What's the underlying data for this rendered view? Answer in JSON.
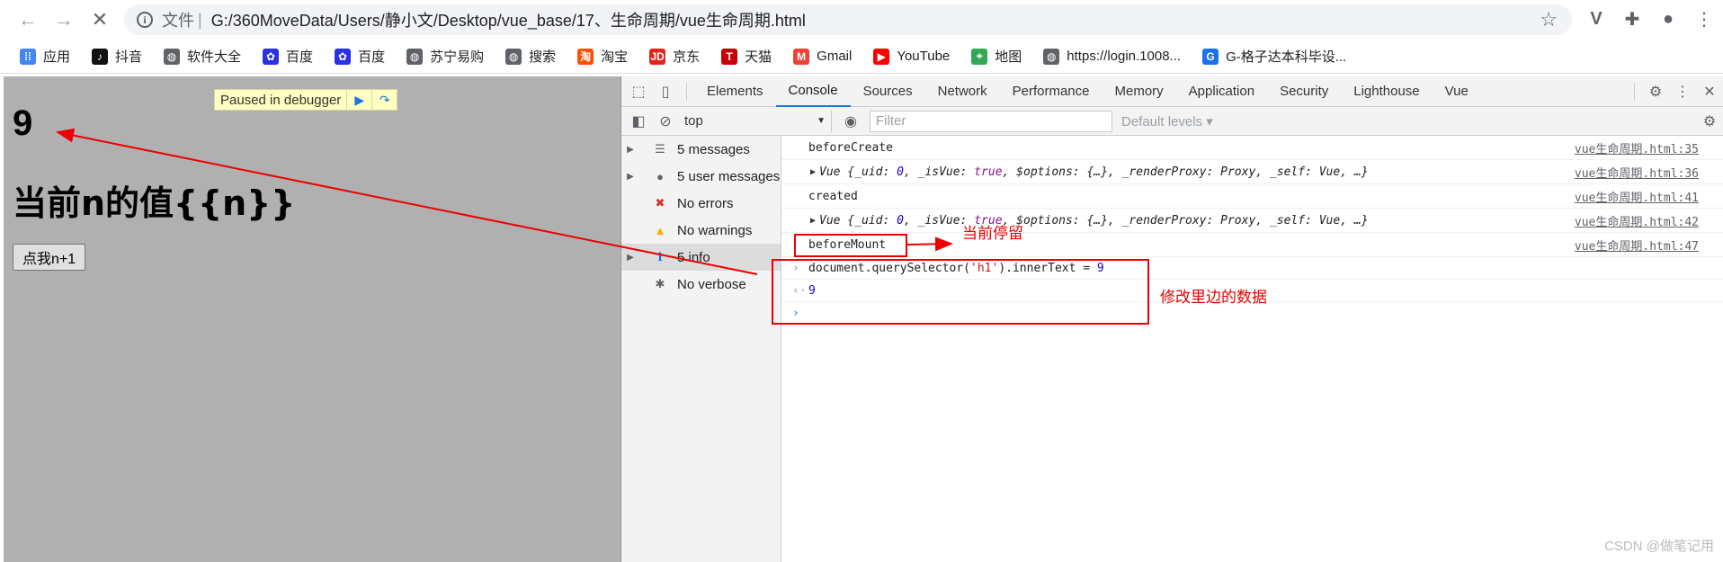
{
  "browser": {
    "scheme": "文件",
    "url": "G:/360MoveData/Users/静小文/Desktop/vue_base/17、生命周期/vue生命周期.html",
    "bookmarks": [
      {
        "label": "应用",
        "icon": "apps-grid-icon"
      },
      {
        "label": "抖音",
        "icon": "douyin-icon"
      },
      {
        "label": "软件大全",
        "icon": "globe-icon"
      },
      {
        "label": "百度",
        "icon": "baidu-paw-icon"
      },
      {
        "label": "百度",
        "icon": "baidu-paw-icon"
      },
      {
        "label": "苏宁易购",
        "icon": "globe-icon"
      },
      {
        "label": "搜索",
        "icon": "globe-icon"
      },
      {
        "label": "淘宝",
        "icon": "taobao-icon"
      },
      {
        "label": "京东",
        "icon": "jd-icon"
      },
      {
        "label": "天猫",
        "icon": "tmall-icon"
      },
      {
        "label": "Gmail",
        "icon": "gmail-icon"
      },
      {
        "label": "YouTube",
        "icon": "youtube-icon"
      },
      {
        "label": "地图",
        "icon": "maps-icon"
      },
      {
        "label": "https://login.1008...",
        "icon": "globe-icon"
      },
      {
        "label": "G-格子达本科毕设...",
        "icon": "gezida-icon"
      }
    ]
  },
  "page": {
    "paused_label": "Paused in debugger",
    "heading": "9",
    "subheading": "当前n的值{{n}}",
    "button_label": "点我n+1"
  },
  "devtools": {
    "tabs": [
      "Elements",
      "Console",
      "Sources",
      "Network",
      "Performance",
      "Memory",
      "Application",
      "Security",
      "Lighthouse",
      "Vue"
    ],
    "active_tab": "Console",
    "context": "top",
    "filter_placeholder": "Filter",
    "levels_label": "Default levels ▾",
    "sidebar": [
      {
        "label": "5 messages",
        "icon": "list-icon",
        "expandable": true
      },
      {
        "label": "5 user messages",
        "icon": "user-icon",
        "expandable": true
      },
      {
        "label": "No errors",
        "icon": "error-icon",
        "expandable": false
      },
      {
        "label": "No warnings",
        "icon": "warning-icon",
        "expandable": false
      },
      {
        "label": "5 info",
        "icon": "info-icon",
        "expandable": true
      },
      {
        "label": "No verbose",
        "icon": "bug-icon",
        "expandable": false
      }
    ],
    "console": {
      "log1": "beforeCreate",
      "src1": "vue生命周期.html:35",
      "obj_prefix": "Vue {",
      "obj_uid_key": "_uid:",
      "obj_uid_val": "0",
      "obj_isvue_key": ", _isVue:",
      "obj_isvue_val": "true",
      "obj_rest": ", $options: {…}, _renderProxy: Proxy, _self: Vue, …}",
      "src2": "vue生命周期.html:36",
      "log3": "created",
      "src3": "vue生命周期.html:41",
      "src4": "vue生命周期.html:42",
      "log5": "beforeMount",
      "src5": "vue生命周期.html:47",
      "cmd_pre": "document.querySelector(",
      "cmd_str": "'h1'",
      "cmd_post": ").innerText = ",
      "cmd_num": "9",
      "result": "9"
    }
  },
  "annotations": {
    "current_stop": "当前停留",
    "modify_data": "修改里边的数据",
    "watermark": "CSDN @做笔记用"
  }
}
